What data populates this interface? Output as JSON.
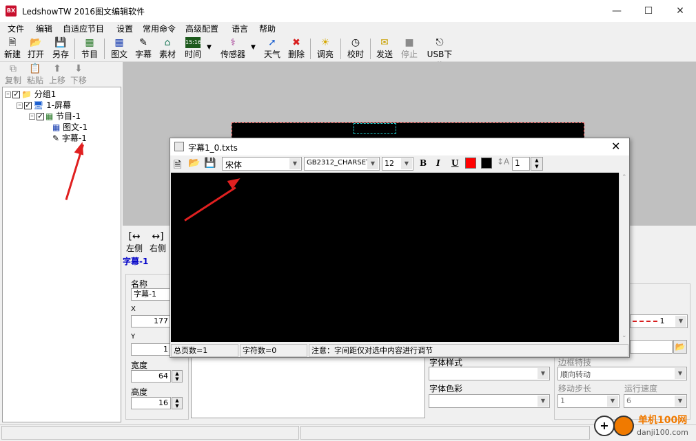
{
  "window": {
    "title": "LedshowTW 2016图文编辑软件",
    "logo_text": "BX"
  },
  "menu": [
    "文件",
    "编辑",
    "自适应节目",
    "设置",
    "常用命令",
    "高级配置",
    "语言",
    "帮助"
  ],
  "toolbar": {
    "new": "新建",
    "open": "打开",
    "saveas": "另存",
    "program": "节目",
    "graphic": "图文",
    "subtitle": "字幕",
    "material": "素材",
    "time": "时间",
    "sensor": "传感器",
    "weather": "天气",
    "delete": "删除",
    "brightness": "调亮",
    "timing": "校时",
    "send": "发送",
    "stop": "停止",
    "usb": "USB下载"
  },
  "small_toolbar": {
    "copy": "复制",
    "paste": "粘贴",
    "up": "上移",
    "down": "下移"
  },
  "tree": {
    "group": "分组1",
    "screen": "1-屏幕",
    "program": "节目-1",
    "graphic": "图文-1",
    "subtitle": "字幕-1"
  },
  "props": {
    "align_left": "左侧",
    "align_right": "右侧",
    "selected": "字幕-1",
    "name_label": "名称",
    "name_value": "字幕-1",
    "x_label": "X",
    "x_value": "177",
    "y_label": "Y",
    "y_value": "1",
    "width_label": "宽度",
    "width_value": "64",
    "height_label": "高度",
    "height_value": "16",
    "font_style_label": "字体样式",
    "font_color_label": "字体色彩",
    "border_effect_label": "边框特技",
    "border_effect_value": "顺向转动",
    "move_step_label": "移动步长",
    "move_step_value": "1",
    "run_speed_label": "运行速度",
    "run_speed_value": "6",
    "border_width_value": "1"
  },
  "dialog": {
    "title": "字幕1_0.txts",
    "font": "宋体",
    "charset": "GB2312_CHARSET",
    "size": "12",
    "spacing": "1",
    "bold": "B",
    "italic": "I",
    "underline": "U",
    "status_pages": "总页数=1",
    "status_chars": "字符数=0",
    "status_note": "注意：字间距仅对选中内容进行调节"
  },
  "watermark": {
    "cn": "单机100网",
    "url": "danji100.com"
  },
  "colors": {
    "font_color": "#ff0000",
    "bg_color": "#000000",
    "arrow": "#e02020"
  }
}
